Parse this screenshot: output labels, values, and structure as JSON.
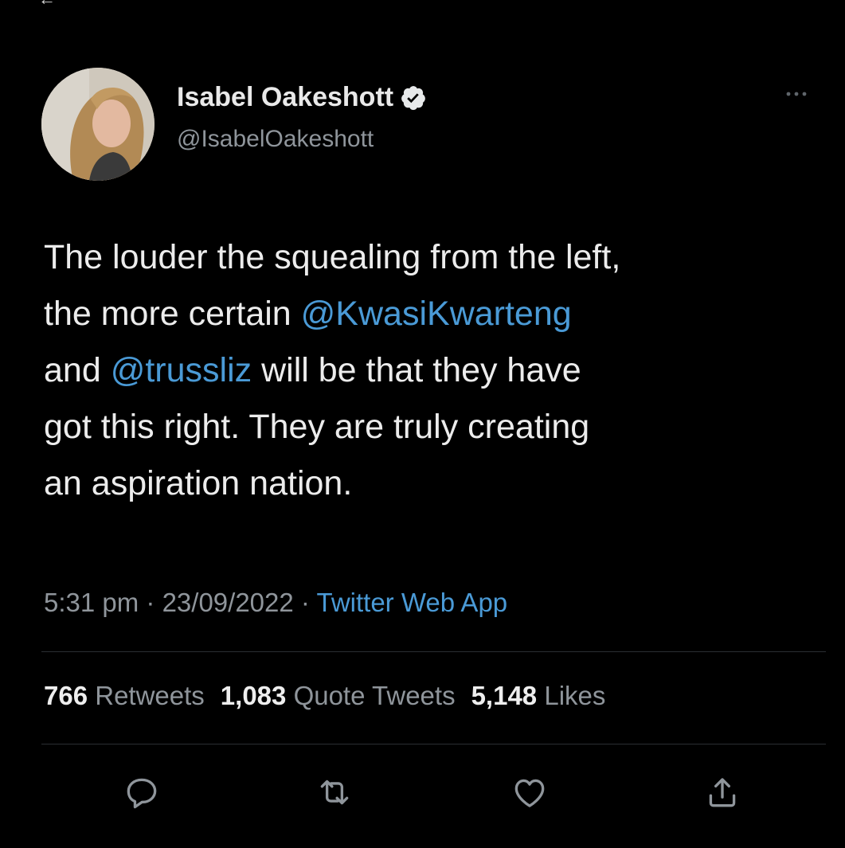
{
  "tweet": {
    "author": {
      "display_name": "Isabel Oakeshott",
      "handle": "@IsabelOakeshott",
      "verified": true
    },
    "text": {
      "segments": [
        {
          "type": "text",
          "value": "The louder the squealing from the left,"
        },
        {
          "type": "br"
        },
        {
          "type": "text",
          "value": "the more certain "
        },
        {
          "type": "mention",
          "value": "@KwasiKwarteng"
        },
        {
          "type": "br"
        },
        {
          "type": "text",
          "value": "and "
        },
        {
          "type": "mention",
          "value": "@trussliz"
        },
        {
          "type": "text",
          "value": " will be that they have"
        },
        {
          "type": "br"
        },
        {
          "type": "text",
          "value": "got this right. They are truly creating"
        },
        {
          "type": "br"
        },
        {
          "type": "text",
          "value": "an aspiration nation."
        }
      ]
    },
    "meta": {
      "time": "5:31 pm",
      "separator": " · ",
      "date": "23/09/2022",
      "source": "Twitter Web App"
    },
    "stats": {
      "retweets_count": "766",
      "retweets_label": "Retweets",
      "quotes_count": "1,083",
      "quotes_label": "Quote Tweets",
      "likes_count": "5,148",
      "likes_label": "Likes"
    },
    "actions": [
      {
        "icon": "reply-icon"
      },
      {
        "icon": "retweet-icon"
      },
      {
        "icon": "like-icon"
      },
      {
        "icon": "share-icon"
      }
    ]
  },
  "colors": {
    "background": "#000000",
    "text": "#ececec",
    "secondary": "#8f959b",
    "link": "#4a9ad6",
    "verified_badge": "#e7e9ea",
    "divider": "#2b2f33"
  }
}
